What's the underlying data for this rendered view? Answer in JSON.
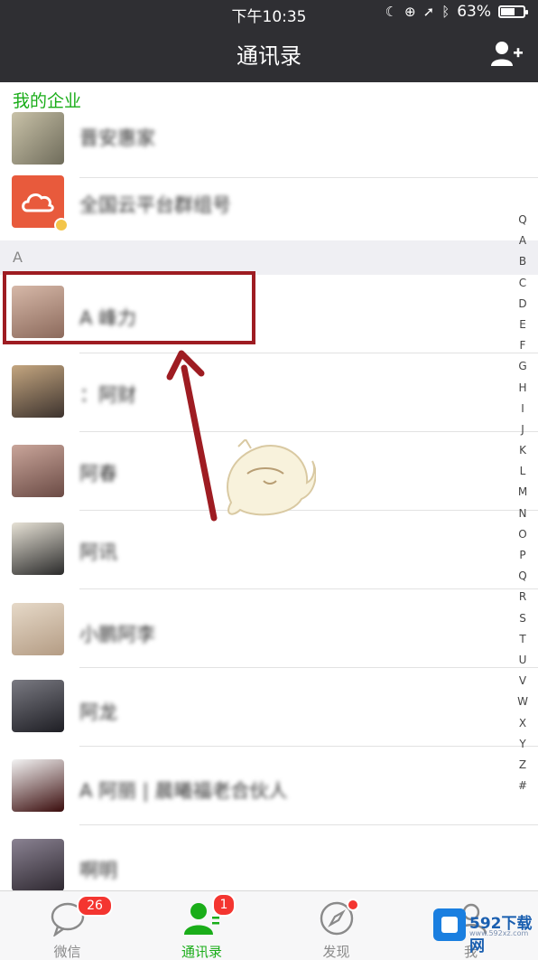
{
  "status_bar": {
    "time": "下午10:35",
    "battery": "63%",
    "battery_level": 0.63
  },
  "nav": {
    "title": "通讯录"
  },
  "sections": {
    "enterprise": "我的企业",
    "a": "A"
  },
  "contacts": [
    {
      "name": "晋安惠家"
    },
    {
      "name": "全国云平台群组号"
    },
    {
      "name": "A 峰力"
    },
    {
      "name": "：阿财"
    },
    {
      "name": "阿春"
    },
    {
      "name": "阿讯"
    },
    {
      "name": "小鹏阿李"
    },
    {
      "name": "阿龙"
    },
    {
      "name": "A 阿丽 | 晨曦福老合伙人"
    },
    {
      "name": "啊明"
    }
  ],
  "index_letters": [
    "Q",
    "A",
    "B",
    "C",
    "D",
    "E",
    "F",
    "G",
    "H",
    "I",
    "J",
    "K",
    "L",
    "M",
    "N",
    "O",
    "P",
    "Q",
    "R",
    "S",
    "T",
    "U",
    "V",
    "W",
    "X",
    "Y",
    "Z",
    "#"
  ],
  "tabs": [
    {
      "label": "微信",
      "badge": "26",
      "icon": "chat-icon"
    },
    {
      "label": "通讯录",
      "badge": "1",
      "icon": "contacts-icon"
    },
    {
      "label": "发现",
      "badge": "",
      "icon": "compass-icon"
    },
    {
      "label": "我",
      "badge": "",
      "icon": "me-icon"
    }
  ],
  "watermark": {
    "text": "592下载网",
    "sub": "www.592xz.com"
  },
  "colors": {
    "nav_bg": "#2f2f33",
    "accent": "#1aad19",
    "badge": "#f43530",
    "highlight": "#9e1c22"
  }
}
